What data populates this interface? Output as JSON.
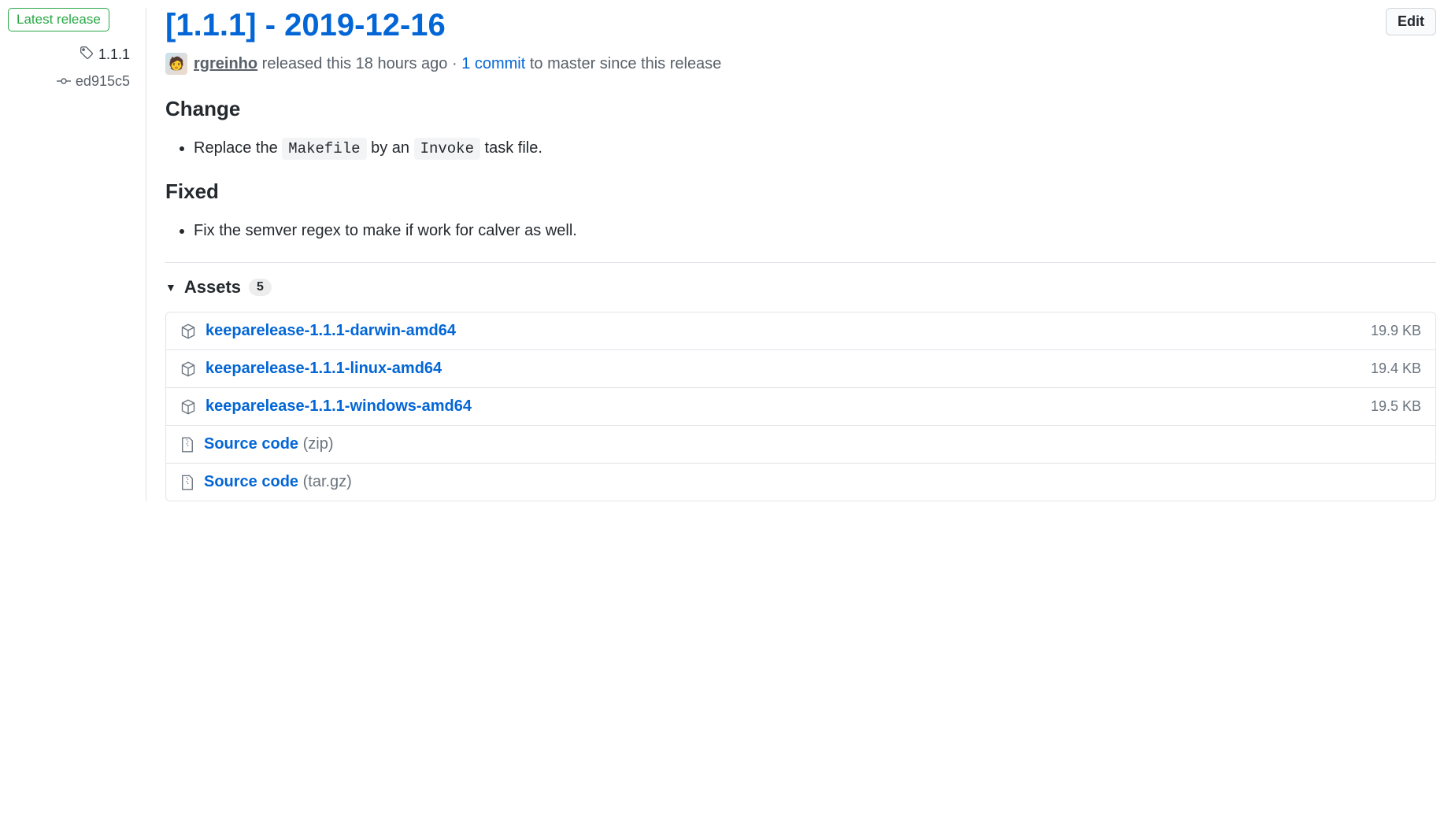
{
  "sidebar": {
    "latest_release_label": "Latest release",
    "tag": "1.1.1",
    "commit": "ed915c5"
  },
  "header": {
    "title": "[1.1.1] - 2019-12-16",
    "edit_button": "Edit"
  },
  "author": {
    "name": "rgreinho",
    "action_prefix": " released this ",
    "time_ago": "18 hours ago",
    "separator": " · ",
    "commits_text": "1 commit",
    "commits_suffix": " to master since this release"
  },
  "body": {
    "section1_heading": "Change",
    "change_item_prefix": "Replace the ",
    "change_code1": "Makefile",
    "change_item_mid": " by an ",
    "change_code2": "Invoke",
    "change_item_suffix": " task file.",
    "section2_heading": "Fixed",
    "fixed_item": "Fix the semver regex to make if work for calver as well."
  },
  "assets": {
    "label": "Assets",
    "count": "5",
    "items": [
      {
        "name": "keeparelease-1.1.1-darwin-amd64",
        "size": "19.9 KB",
        "type": "package"
      },
      {
        "name": "keeparelease-1.1.1-linux-amd64",
        "size": "19.4 KB",
        "type": "package"
      },
      {
        "name": "keeparelease-1.1.1-windows-amd64",
        "size": "19.5 KB",
        "type": "package"
      },
      {
        "name": "Source code",
        "ext": "(zip)",
        "size": "",
        "type": "zip"
      },
      {
        "name": "Source code",
        "ext": "(tar.gz)",
        "size": "",
        "type": "zip"
      }
    ]
  }
}
